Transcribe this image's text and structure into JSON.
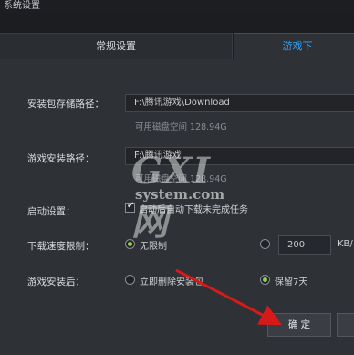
{
  "window": {
    "title": "系统设置"
  },
  "tabs": {
    "general": "常规设置",
    "game": "游戏下"
  },
  "settings": {
    "pkg_path_label": "安装包存储路径：",
    "pkg_path_value": "F:\\腾讯游戏\\Download",
    "pkg_free": "可用磁盘空间 128.94G",
    "install_path_label": "游戏安装路径：",
    "install_path_value": "F:\\腾讯游戏",
    "install_free": "可用磁盘空间 128.94G",
    "startup_label": "启动设置：",
    "startup_check": "启动后自动下载未完成任务",
    "speed_label": "下载速度限制：",
    "speed_unlimited": "无限制",
    "speed_value": "200",
    "speed_unit": "KB/",
    "after_install_label": "游戏安装后：",
    "delete_pkg": "立即删除安装包",
    "keep_days": "保留7天"
  },
  "buttons": {
    "ok": "确 定"
  },
  "watermark": {
    "big": "GXI网",
    "small": "system.com"
  },
  "colors": {
    "accent": "#2aa3ff",
    "radio_on": "#8fd14f",
    "arrow": "#d61a1a"
  }
}
